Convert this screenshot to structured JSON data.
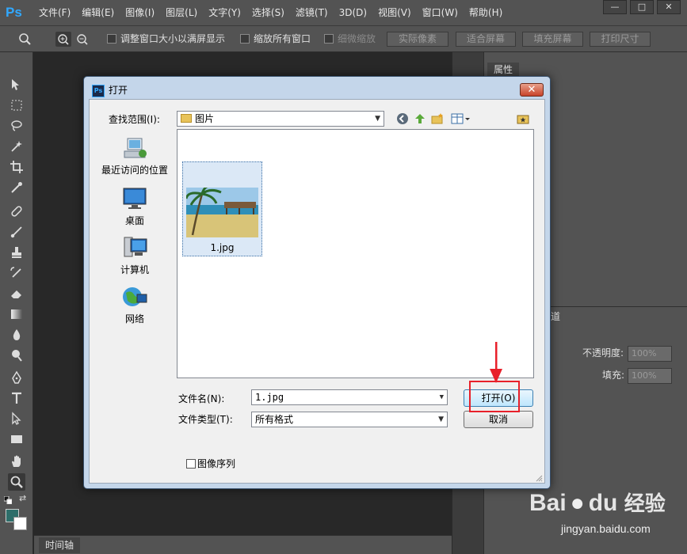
{
  "app": {
    "logo": "Ps",
    "menu": [
      "文件(F)",
      "编辑(E)",
      "图像(I)",
      "图层(L)",
      "文字(Y)",
      "选择(S)",
      "滤镜(T)",
      "3D(D)",
      "视图(V)",
      "窗口(W)",
      "帮助(H)"
    ],
    "window_controls": [
      "—",
      "□",
      "✕"
    ]
  },
  "options": {
    "resize_windows": "调整窗口大小以满屏显示",
    "zoom_all": "缩放所有窗口",
    "scrubby_zoom": "细微缩放",
    "actual_pixels": "实际像素",
    "fit_screen": "适合屏幕",
    "fill_screen": "填充屏幕",
    "print_size": "打印尺寸"
  },
  "panels": {
    "properties_tab": "属性",
    "opacity_label": "不透明度:",
    "opacity_value": "100%",
    "fill_label": "填充:",
    "fill_value": "100%",
    "channels_fragment": "道"
  },
  "timeline": {
    "tab": "时间轴"
  },
  "dialog": {
    "title": "打开",
    "close": "✕",
    "look_in_label": "查找范围(I):",
    "look_in_value": "图片",
    "places": [
      {
        "label": "最近访问的位置",
        "icon": "recent-places-icon"
      },
      {
        "label": "桌面",
        "icon": "desktop-icon"
      },
      {
        "label": "计算机",
        "icon": "computer-icon"
      },
      {
        "label": "网络",
        "icon": "network-icon"
      }
    ],
    "file": {
      "name": "1.jpg"
    },
    "file_name_label": "文件名(N):",
    "file_name_value": "1.jpg",
    "file_type_label": "文件类型(T):",
    "file_type_value": "所有格式",
    "open_button": "打开(O)",
    "cancel_button": "取消",
    "image_sequence": "图像序列"
  },
  "watermark": {
    "brand": "Bai",
    "brand2": "du",
    "suffix": "经验",
    "url": "jingyan.baidu.com"
  },
  "colors": {
    "accent": "#31a8ff",
    "annotation": "#e8202a",
    "foreground": "#2e6e6a",
    "background": "#ffffff"
  }
}
